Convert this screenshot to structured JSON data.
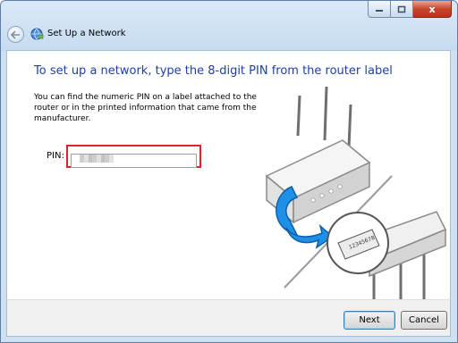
{
  "window": {
    "title": "Set Up a Network",
    "close_glyph": "x"
  },
  "main": {
    "heading": "To set up a network, type the 8-digit PIN from the router label",
    "description": "You can find the numeric PIN on a label attached to the router or in the printed information that came from the manufacturer.",
    "pin_label": "PIN:",
    "pin_value": "",
    "label_text": "12345678"
  },
  "footer": {
    "next_label": "Next",
    "cancel_label": "Cancel"
  },
  "colors": {
    "heading": "#1e3fa6",
    "highlight": "#e0232a",
    "arrow": "#1e90e8"
  },
  "icons": [
    "back-arrow-icon",
    "network-icon",
    "minimize-icon",
    "maximize-icon",
    "close-icon",
    "router-icon",
    "arrow-icon",
    "router-label-icon"
  ]
}
